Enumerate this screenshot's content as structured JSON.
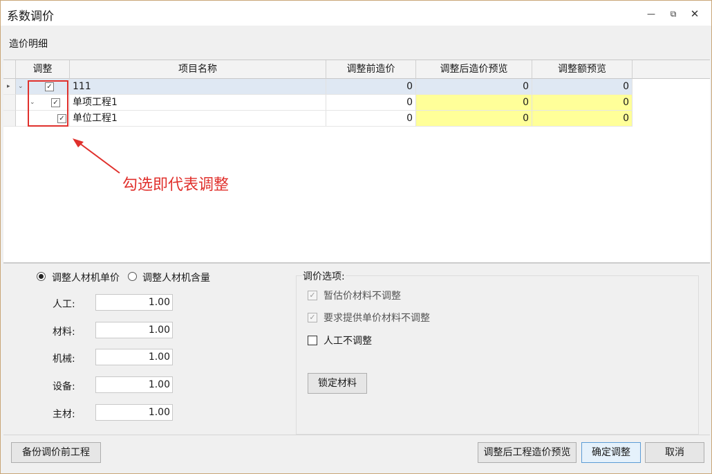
{
  "window": {
    "title": "系数调价",
    "minimize_icon": "minimize-icon",
    "restore_icon": "restore-icon",
    "close_icon": "close-icon"
  },
  "section_label": "造价明细",
  "grid": {
    "columns": [
      "调整",
      "项目名称",
      "调整前造价",
      "调整后造价预览",
      "调整额预览"
    ],
    "rows": [
      {
        "name": "111",
        "before": "0",
        "after": "0",
        "diff": "0",
        "checked": true
      },
      {
        "name": "单项工程1",
        "before": "0",
        "after": "0",
        "diff": "0",
        "checked": true
      },
      {
        "name": "单位工程1",
        "before": "0",
        "after": "0",
        "diff": "0",
        "checked": true
      }
    ],
    "highlight_color": "#ffff99"
  },
  "annotation": {
    "text": "勾选即代表调整",
    "color": "#e0302c"
  },
  "mode": {
    "option1": "调整人材机单价",
    "option2": "调整人材机含量",
    "selected": "option1"
  },
  "coefficients": [
    {
      "label": "人工:",
      "value": "1.00"
    },
    {
      "label": "材料:",
      "value": "1.00"
    },
    {
      "label": "机械:",
      "value": "1.00"
    },
    {
      "label": "设备:",
      "value": "1.00"
    },
    {
      "label": "主材:",
      "value": "1.00"
    }
  ],
  "options": {
    "title": "调价选项:",
    "items": [
      {
        "label": "暂估价材料不调整",
        "checked": true,
        "enabled": false
      },
      {
        "label": "要求提供单价材料不调整",
        "checked": true,
        "enabled": false
      },
      {
        "label": "人工不调整",
        "checked": false,
        "enabled": true
      }
    ],
    "lock_button": "锁定材料"
  },
  "footer": {
    "backup_button": "备份调价前工程",
    "preview_button": "调整后工程造价预览",
    "confirm_button": "确定调整",
    "cancel_button": "取消"
  }
}
